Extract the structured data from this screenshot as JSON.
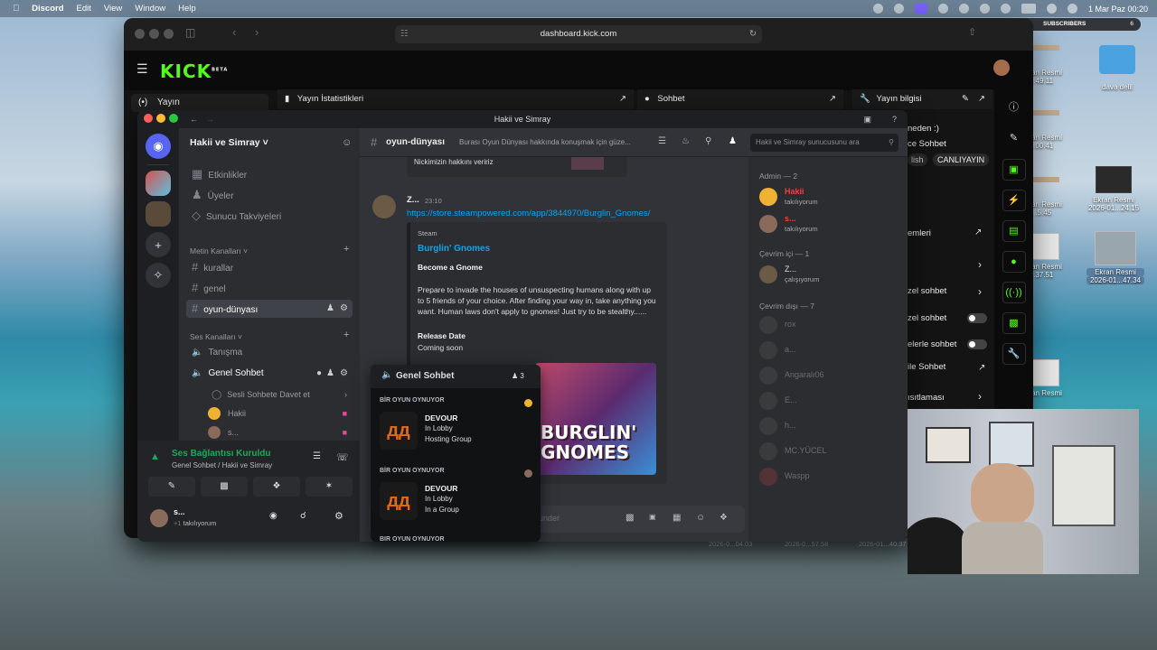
{
  "menubar": {
    "app": "Discord",
    "items": [
      "Edit",
      "View",
      "Window",
      "Help"
    ],
    "clock": "1 Mar Paz  00:20"
  },
  "desktop": {
    "icons": [
      {
        "label": "Ekran Resmi",
        "sub": "...49.11"
      },
      {
        "label": "dava delil",
        "sub": ""
      },
      {
        "label": "Ekran Resmi",
        "sub": "...00.41"
      },
      {
        "label": "Ekran Resmi",
        "sub": "...5.45"
      },
      {
        "label": "Ekran Resmi",
        "sub": "2026-01...24.15"
      },
      {
        "label": "Ekran Resmi",
        "sub": "...37.51"
      },
      {
        "label": "Ekran Resmi",
        "sub": "2026-01...47.34"
      },
      {
        "label": "Ekran Resmi",
        "sub": ""
      }
    ],
    "bottom_labels": [
      "2026-0...04.03",
      "2026-0...57.58",
      "2026-01...40.37"
    ]
  },
  "subscribers": {
    "label": "SUBSCRIBERS",
    "count": "6"
  },
  "safari": {
    "url": "dashboard.kick.com"
  },
  "kick": {
    "logo": "KICK",
    "logo_badge": "BETA",
    "stream_label": "Yayın",
    "panels": {
      "stats": "Yayın İstatistikleri",
      "chat": "Sohbet",
      "info": "Yayın bilgisi"
    },
    "right_fragments": [
      "neden :)",
      "ce Sohbet",
      "lish",
      "CANLIYAYIN"
    ],
    "settings_title": "emleri",
    "settings_rows": [
      "zel sohbet",
      "zel sohbet",
      "elerle sohbet",
      "ile Sohbet",
      "ısıtlaması"
    ]
  },
  "discord": {
    "title": "Hakii ve Simray",
    "server_name": "Hakii ve Simray",
    "channel_items": [
      {
        "icon": "calendar-icon",
        "label": "Etkinlikler"
      },
      {
        "icon": "members-icon",
        "label": "Üyeler"
      },
      {
        "icon": "boost-icon",
        "label": "Sunucu Takviyeleri"
      }
    ],
    "text_category": "Metin Kanalları",
    "text_channels": [
      "kurallar",
      "genel",
      "oyun-dünyası"
    ],
    "voice_category": "Ses Kanalları",
    "voice_channels": [
      "Tanışma",
      "Genel Sohbet"
    ],
    "voice_sub": {
      "invite": "Sesli Sohbete Davet et",
      "users": [
        "Hakii",
        "s..."
      ]
    },
    "voice_status": {
      "title": "Ses Bağlantısı Kuruldu",
      "sub": "Genel Sohbet / Hakii ve Simray"
    },
    "user": {
      "name": "s...",
      "status": "takılıyorum",
      "badge": "+1"
    },
    "chat_header": {
      "channel": "oyun-dünyası",
      "topic": "Burası Oyun Dünyası hakkında konuşmak için güze...",
      "search_placeholder": "Hakii ve Simray sunucusunu ara"
    },
    "message": {
      "prev_text": "Nickimizin hakkını veririz",
      "author": "Z...",
      "time": "23:10",
      "link": "https://store.steampowered.com/app/3844970/Burglin_Gnomes/",
      "embed": {
        "provider": "Steam",
        "title": "Burglin' Gnomes",
        "subtitle": "Become a Gnome",
        "description": "Prepare to invade the houses of unsuspecting humans along with up to 5 friends of your choice. After finding your way in, take anything you want. Human laws don't apply to gnomes! Just try to be stealthy......",
        "release_label": "Release Date",
        "release_value": "Coming soon",
        "image_text": "BURGLIN' GNOMES"
      }
    },
    "composer_placeholder": "under",
    "popout": {
      "channel": "Genel Sohbet",
      "count": "3",
      "activities": [
        {
          "heading": "BİR OYUN OYNUYOR",
          "game": "DEVOUR",
          "l1": "In Lobby",
          "l2": "Hosting Group"
        },
        {
          "heading": "BİR OYUN OYNUYOR",
          "game": "DEVOUR",
          "l1": "In Lobby",
          "l2": "In a Group"
        }
      ],
      "partial": "BİR OYUN OYNUYOR"
    },
    "members": {
      "admin_head": "Admin — 2",
      "admins": [
        {
          "name": "Hakii",
          "status": "takılıyorum",
          "color": "#f23f42"
        },
        {
          "name": "s...",
          "status": "takılıyorum",
          "color": "#f23f42"
        }
      ],
      "online_head": "Çevrim içi — 1",
      "online": [
        {
          "name": "Z...",
          "status": "çalışıyorum"
        }
      ],
      "offline_head": "Çevrim dışı — 7",
      "offline": [
        "rox",
        "a...",
        "Angaralı06",
        "E...",
        "h...",
        "MC.YÜCEL",
        "Waspp"
      ]
    }
  }
}
